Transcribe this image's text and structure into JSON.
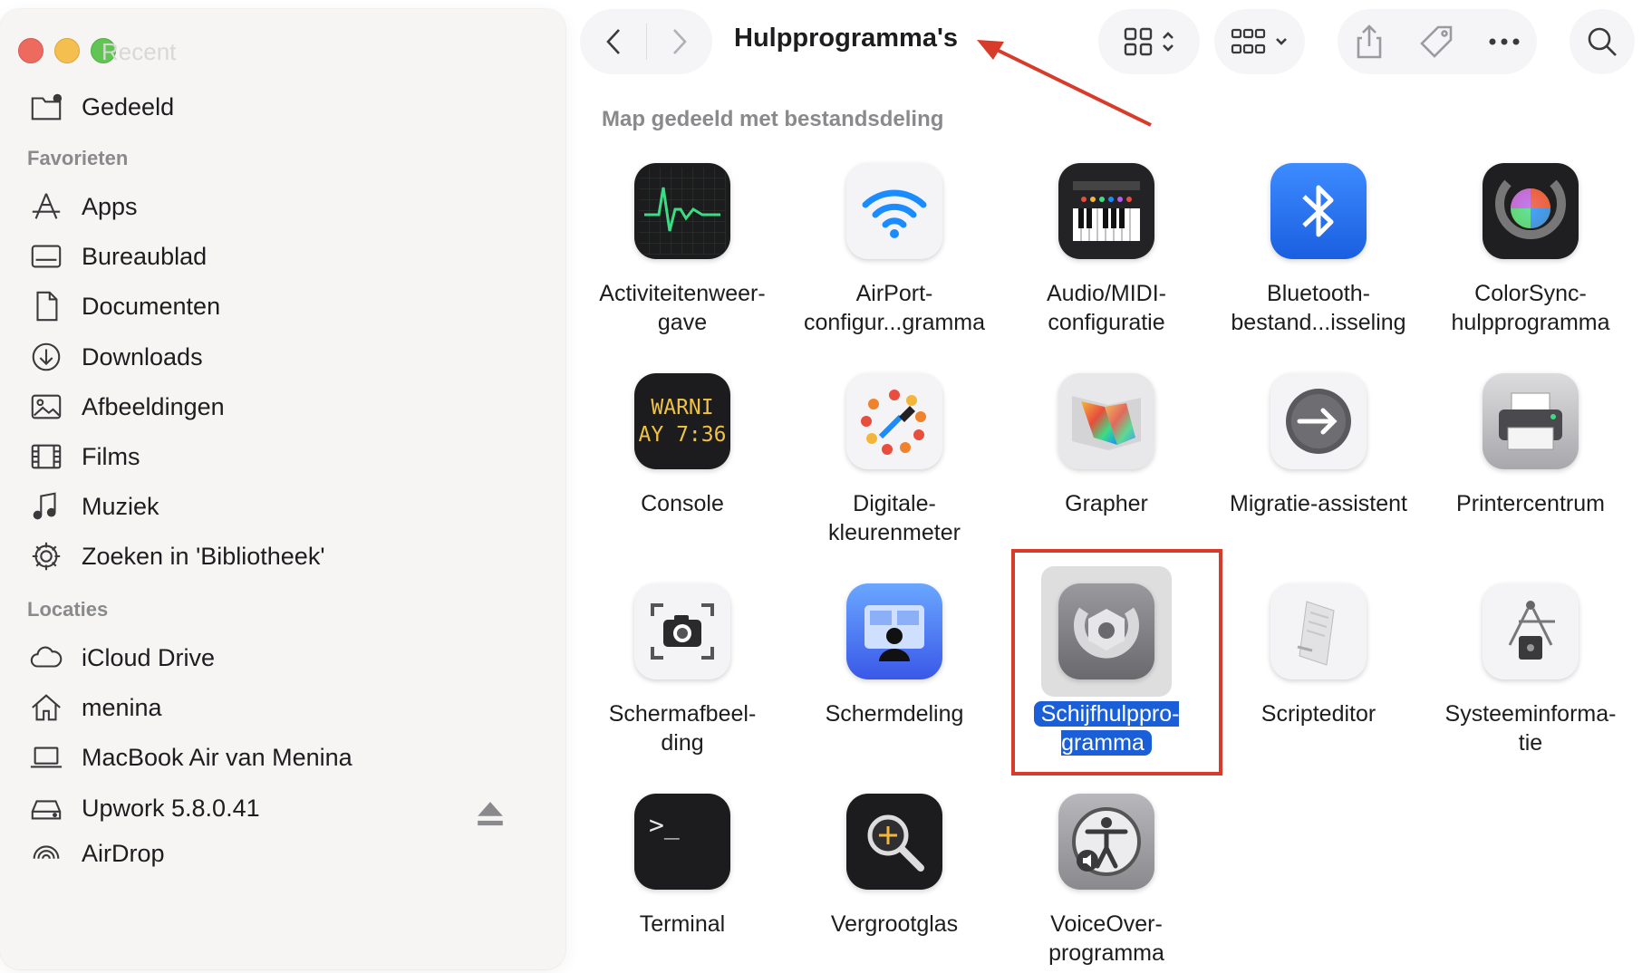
{
  "window": {
    "title": "Hulpprogramma's",
    "path_label": "Map gedeeld met bestandsdeling",
    "ghost_title": "Recent"
  },
  "sidebar": {
    "top_item": {
      "label": "Gedeeld",
      "icon": "shared-folder-icon"
    },
    "favorites_title": "Favorieten",
    "favorites": [
      {
        "label": "Apps",
        "icon": "apps-icon"
      },
      {
        "label": "Bureaublad",
        "icon": "desktop-icon"
      },
      {
        "label": "Documenten",
        "icon": "document-icon"
      },
      {
        "label": "Downloads",
        "icon": "download-icon"
      },
      {
        "label": "Afbeeldingen",
        "icon": "photo-icon"
      },
      {
        "label": "Films",
        "icon": "film-icon"
      },
      {
        "label": "Muziek",
        "icon": "music-icon"
      },
      {
        "label": "Zoeken in 'Bibliotheek'",
        "icon": "gear-icon"
      }
    ],
    "locations_title": "Locaties",
    "locations": [
      {
        "label": "iCloud Drive",
        "icon": "cloud-icon"
      },
      {
        "label": "menina",
        "icon": "home-icon"
      },
      {
        "label": "MacBook Air van Menina",
        "icon": "laptop-icon"
      },
      {
        "label": "Upwork 5.8.0.41",
        "icon": "drive-icon"
      },
      {
        "label": "AirDrop",
        "icon": "airdrop-icon"
      }
    ]
  },
  "apps": [
    {
      "label": "Activiteitenweer-\ngave",
      "icon": "activity-monitor-icon"
    },
    {
      "label": "AirPort-\nconfigur...gramma",
      "icon": "wifi-icon"
    },
    {
      "label": "Audio/MIDI-\nconfiguratie",
      "icon": "piano-icon"
    },
    {
      "label": "Bluetooth-\nbestand...isseling",
      "icon": "bluetooth-icon"
    },
    {
      "label": "ColorSync-\nhulpprogramma",
      "icon": "colorsync-icon"
    },
    {
      "label": "Console",
      "icon": "console-icon",
      "screen_text_1": "WARNI",
      "screen_text_2": "AY 7:36"
    },
    {
      "label": "Digitale-\nkleurenmeter",
      "icon": "color-meter-icon"
    },
    {
      "label": "Grapher",
      "icon": "grapher-icon"
    },
    {
      "label": "Migratie-assistent",
      "icon": "migration-icon"
    },
    {
      "label": "Printercentrum",
      "icon": "printer-icon"
    },
    {
      "label": "Schermafbeel-\nding",
      "icon": "screenshot-icon"
    },
    {
      "label": "Schermdeling",
      "icon": "screen-sharing-icon"
    },
    {
      "label": "Schijfhulppro-\ngramma",
      "icon": "disk-utility-icon",
      "selected": true
    },
    {
      "label": "Scripteditor",
      "icon": "script-editor-icon"
    },
    {
      "label": "Systeeminforma-\ntie",
      "icon": "system-info-icon"
    },
    {
      "label": "Terminal",
      "icon": "terminal-icon",
      "screen_text": ">_"
    },
    {
      "label": "Vergrootglas",
      "icon": "magnifier-icon"
    },
    {
      "label": "VoiceOver-\nprogramma",
      "icon": "voiceover-icon"
    }
  ],
  "colors": {
    "selection": "#1a5fd8",
    "annotation": "#d93b2b"
  }
}
